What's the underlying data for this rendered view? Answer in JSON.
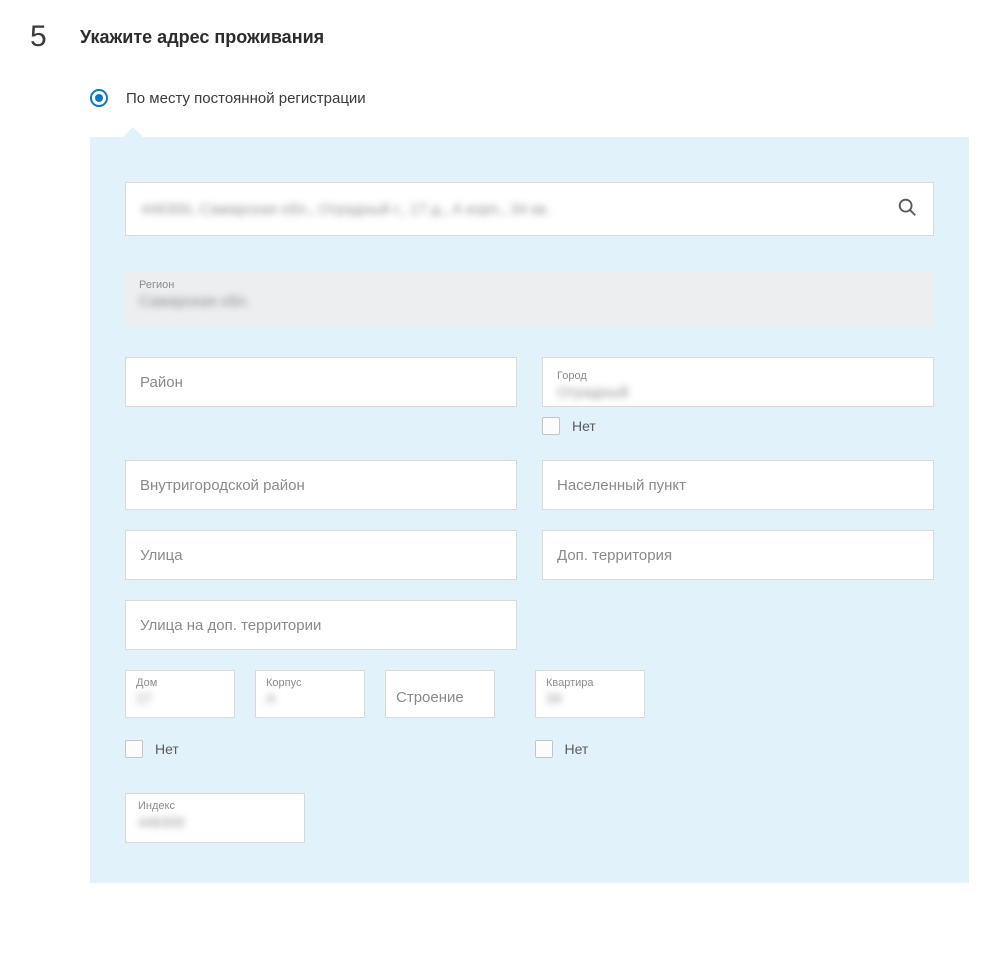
{
  "step": {
    "number": "5",
    "title": "Укажите адрес проживания"
  },
  "radio": {
    "label": "По месту постоянной регистрации"
  },
  "search": {
    "blurred_value": "446300, Самарская обл., Отрадный г., 17 д., А корп., 34 кв."
  },
  "region": {
    "label": "Регион",
    "blurred_value": "Самарская обл."
  },
  "district": {
    "placeholder": "Район"
  },
  "city": {
    "label": "Город",
    "blurred_value": "Отрадный",
    "no_label": "Нет"
  },
  "inner_district": {
    "placeholder": "Внутригородской район"
  },
  "settlement": {
    "placeholder": "Населенный пункт"
  },
  "street": {
    "placeholder": "Улица"
  },
  "add_territory": {
    "placeholder": "Доп. территория"
  },
  "street_on_add": {
    "placeholder": "Улица на доп. территории"
  },
  "house": {
    "label": "Дом",
    "blurred_value": "17"
  },
  "korpus": {
    "label": "Корпус",
    "blurred_value": "А"
  },
  "building": {
    "placeholder": "Строение"
  },
  "flat": {
    "label": "Квартира",
    "blurred_value": "34"
  },
  "no_house": "Нет",
  "no_flat": "Нет",
  "index": {
    "label": "Индекс",
    "blurred_value": "446300"
  }
}
